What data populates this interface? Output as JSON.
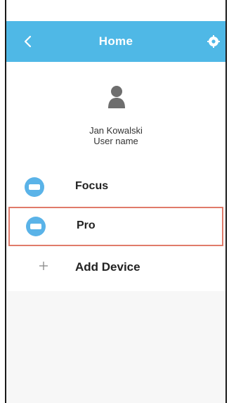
{
  "header": {
    "title": "Home",
    "back_icon": "chevron-left-icon",
    "settings_icon": "gear-icon",
    "color": "#4fb8e6"
  },
  "profile": {
    "avatar_icon": "user-silhouette-icon",
    "name": "Jan Kowalski",
    "subtitle": "User name"
  },
  "devices": [
    {
      "label": "Focus",
      "icon": "ac-unit-icon",
      "selected": false
    },
    {
      "label": "Pro",
      "icon": "ac-unit-icon",
      "selected": true
    }
  ],
  "add_device": {
    "label": "Add Device",
    "icon": "plus-icon"
  },
  "colors": {
    "device_icon": "#5ab3e8",
    "selection_border": "#e07b6a",
    "background": "#f7f7f7"
  }
}
